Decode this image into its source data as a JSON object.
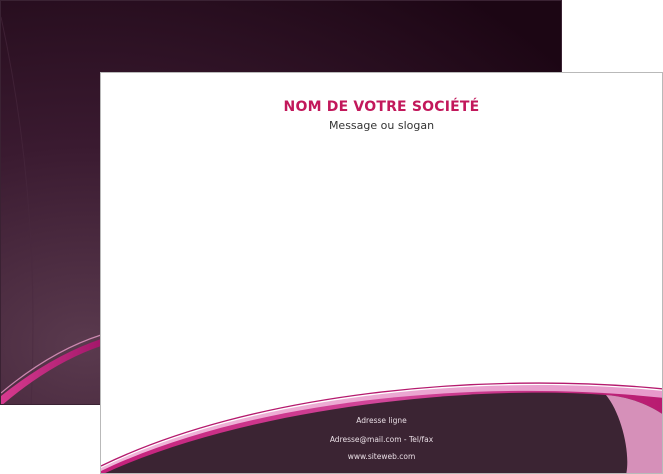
{
  "document": {
    "company_name": "NOM DE VOTRE SOCIÉTÉ",
    "slogan": "Message ou slogan",
    "address": "Adresse ligne",
    "contact": "Adresse@mail.com - Tel/fax",
    "website": "www.siteweb.com"
  },
  "colors": {
    "back_dark": "#2a0f22",
    "back_gradient_light": "#5a3a4e",
    "accent_pink": "#c2185b",
    "light_pink": "#e89cc8",
    "footer_dark": "#3b2433"
  }
}
